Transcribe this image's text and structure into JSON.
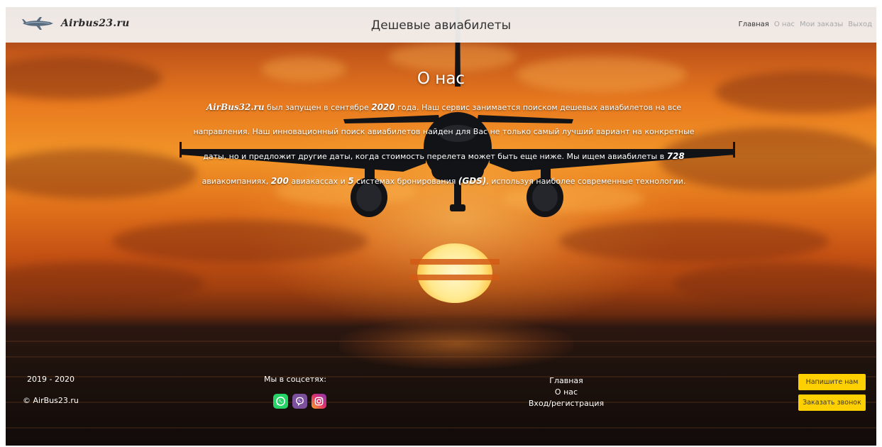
{
  "header": {
    "logo_text": "Airbus23.ru",
    "title": "Дешевые авиабилеты",
    "nav": [
      {
        "label": "Главная",
        "active": true
      },
      {
        "label": "О нас",
        "active": false
      },
      {
        "label": "Мои заказы",
        "active": false
      },
      {
        "label": "Выход",
        "active": false
      }
    ]
  },
  "about": {
    "title": "О нас",
    "brand": "AirBus32.ru",
    "text1": " был запущен в сентябре ",
    "year": "2020",
    "text2": " года. Наш сервис занимается поиском дешевых авиабилетов на все направления. Наш инновационный поиск авиабилетов найден для Вас не только самый лучший вариант на конкретные даты, но и предложит другие даты, когда стоимость перелета может быть еще ниже. Мы ищем авиабилеты в ",
    "airlines_count": "728",
    "text3": " авиакомпаниях, ",
    "offices_count": "200",
    "text4": " авиакассах и ",
    "systems_count": "5",
    "text5": " системах бронирования ",
    "gds": "(GDS)",
    "text6": ", используя наиболее современные технологии."
  },
  "footer": {
    "years": "2019 - 2020",
    "copyright": "© AirBus23.ru",
    "social_label": "Мы в соцсетях:",
    "social_icons": [
      "whatsapp-icon",
      "viber-icon",
      "instagram-icon"
    ],
    "links": [
      "Главная",
      "О нас",
      "Вход/регистрация"
    ],
    "write_button": "Напишите нам",
    "call_button": "Заказать звонок"
  },
  "colors": {
    "button": "#ffd000",
    "header_bg": "#f5f3f1",
    "whatsapp": "#25d366",
    "viber": "#7b519d"
  }
}
